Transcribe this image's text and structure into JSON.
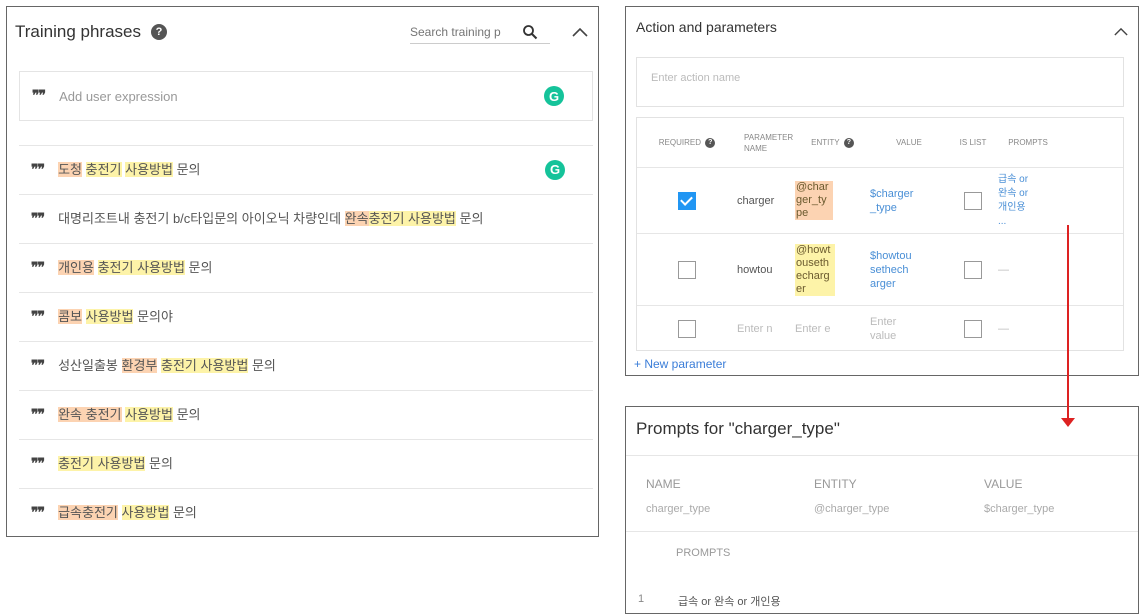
{
  "training": {
    "title": "Training phrases",
    "search_placeholder": "Search training p",
    "add_placeholder": "Add user expression",
    "phrases": [
      [
        {
          "t": "도청",
          "h": "o"
        },
        {
          "t": " "
        },
        {
          "t": "충전기",
          "h": "y"
        },
        {
          "t": " "
        },
        {
          "t": "사용방법",
          "h": "y"
        },
        {
          "t": " 문의"
        }
      ],
      [
        {
          "t": "대명리조트내 충전기 b/c타입문의 아이오닉 차량인데 "
        },
        {
          "t": "완속",
          "h": "o"
        },
        {
          "t": "충전기 사용방법",
          "h": "y"
        },
        {
          "t": " 문의"
        }
      ],
      [
        {
          "t": "개인용",
          "h": "o"
        },
        {
          "t": " "
        },
        {
          "t": "충전기 사용방법",
          "h": "y"
        },
        {
          "t": " 문의"
        }
      ],
      [
        {
          "t": "콤보",
          "h": "o"
        },
        {
          "t": " "
        },
        {
          "t": "사용방법",
          "h": "y"
        },
        {
          "t": " 문의야"
        }
      ],
      [
        {
          "t": "성산일출봉 "
        },
        {
          "t": "환경부",
          "h": "o"
        },
        {
          "t": " "
        },
        {
          "t": "충전기 사용방법",
          "h": "y"
        },
        {
          "t": " 문의"
        }
      ],
      [
        {
          "t": "완속 충전기",
          "h": "o"
        },
        {
          "t": " "
        },
        {
          "t": "사용방법",
          "h": "y"
        },
        {
          "t": " 문의"
        }
      ],
      [
        {
          "t": "충전기 사용방법",
          "h": "y"
        },
        {
          "t": " 문의"
        }
      ],
      [
        {
          "t": "급속충전기",
          "h": "o"
        },
        {
          "t": " "
        },
        {
          "t": "사용방법",
          "h": "y"
        },
        {
          "t": " 문의"
        }
      ]
    ]
  },
  "action": {
    "title": "Action and parameters",
    "action_placeholder": "Enter action name",
    "headers": {
      "required": "REQUIRED",
      "param_name": "PARAMETER NAME",
      "entity": "ENTITY",
      "value": "VALUE",
      "is_list": "IS LIST",
      "prompts": "PROMPTS"
    },
    "rows": [
      {
        "required": true,
        "name": "charger",
        "entity": "@charger_type",
        "value": "$charger_type",
        "is_list": false,
        "prompts": "급속 or 완속 or 개인용 ..."
      },
      {
        "required": false,
        "name": "howtou",
        "entity": "@howtousethecharger",
        "value": "$howtousethecharger",
        "is_list": false,
        "prompts": "—"
      },
      {
        "required": false,
        "name": "Enter n",
        "entity": "Enter e",
        "value": "Enter value",
        "is_list": false,
        "prompts": "—"
      }
    ],
    "new_parameter": "+ New parameter"
  },
  "prompts_dialog": {
    "title": "Prompts for \"charger_type\"",
    "name_label": "NAME",
    "entity_label": "ENTITY",
    "value_label": "VALUE",
    "name": "charger_type",
    "entity": "@charger_type",
    "value": "$charger_type",
    "prompts_label": "PROMPTS",
    "prompt_number": "1",
    "prompt_text": "급속 or 완속 or 개인용"
  },
  "colors": {
    "entity_orange": "#fcd3b2",
    "entity_yellow": "#fdf3a8",
    "link_blue": "#4a8fd6",
    "checkbox_blue": "#2196f3",
    "grammarly_green": "#15c39a",
    "arrow_red": "#dd2222"
  }
}
